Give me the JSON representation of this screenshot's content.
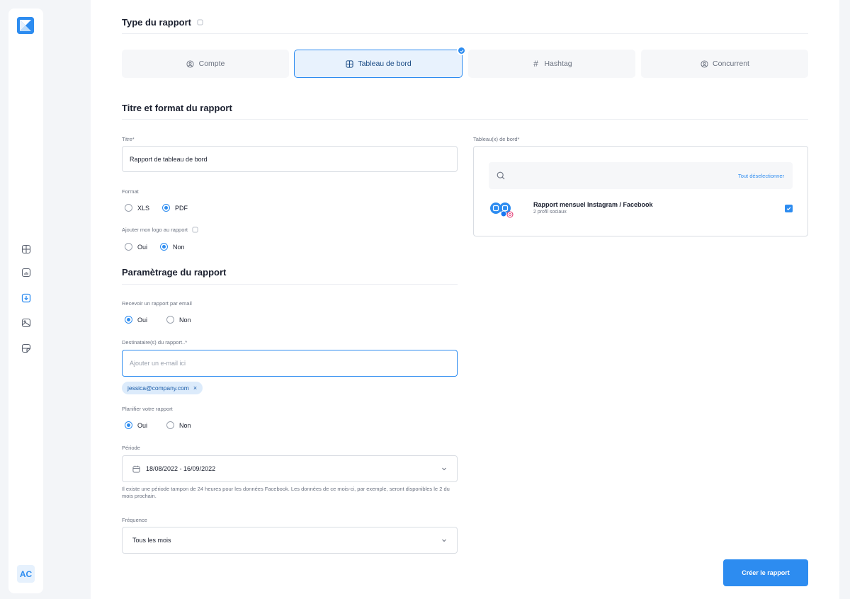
{
  "sidebar": {
    "avatar": "AC",
    "items": [
      {
        "icon": "dashboard-icon"
      },
      {
        "icon": "analytics-icon"
      },
      {
        "icon": "download-icon"
      },
      {
        "icon": "image-icon"
      },
      {
        "icon": "note-icon"
      }
    ]
  },
  "report_type": {
    "title": "Type du rapport",
    "tabs": [
      {
        "label": "Compte",
        "icon": "user-icon"
      },
      {
        "label": "Tableau de bord",
        "icon": "dashboard-icon",
        "active": true
      },
      {
        "label": "Hashtag",
        "icon": "hashtag-icon"
      },
      {
        "label": "Concurrent",
        "icon": "user-icon"
      }
    ]
  },
  "title_format": {
    "title": "Titre et format du rapport",
    "title_label": "Titre*",
    "title_value": "Rapport de tableau de bord",
    "format_label": "Format",
    "format_options": [
      "XLS",
      "PDF"
    ],
    "format_selected": "PDF",
    "logo_label": "Ajouter mon logo au rapport",
    "logo_options": [
      "Oui",
      "Non"
    ],
    "logo_selected": "Non"
  },
  "dashboards": {
    "label": "Tableau(x) de bord*",
    "deselect_all": "Tout déselectionner",
    "items": [
      {
        "name": "Rapport mensuel Instagram / Facebook",
        "sub": "2 profil sociaux",
        "checked": true
      }
    ]
  },
  "settings": {
    "title": "Paramètrage du rapport",
    "email_label": "Recevoir un rapport par email",
    "email_options": [
      "Oui",
      "Non"
    ],
    "email_selected": "Oui",
    "recipients_label": "Destinataire(s) du rapport..*",
    "recipients_placeholder": "Ajouter un e-mail ici",
    "recipients": [
      "jessica@company.com"
    ],
    "schedule_label": "Planifier votre rapport",
    "schedule_options": [
      "Oui",
      "Non"
    ],
    "schedule_selected": "Oui",
    "period_label": "Période",
    "period_value": "18/08/2022 - 16/09/2022",
    "period_help": "Il existe une période tampon de 24 heures pour les données Facebook. Les données de ce mois-ci, par exemple, seront disponibles le 2 du mois prochain.",
    "frequency_label": "Fréquence",
    "frequency_value": "Tous les mois"
  },
  "actions": {
    "create": "Créer le rapport"
  },
  "colors": {
    "accent": "#2d8cf0",
    "accent_light": "#e8f2fd",
    "text": "#1a1f2e",
    "muted": "#6b7280"
  }
}
